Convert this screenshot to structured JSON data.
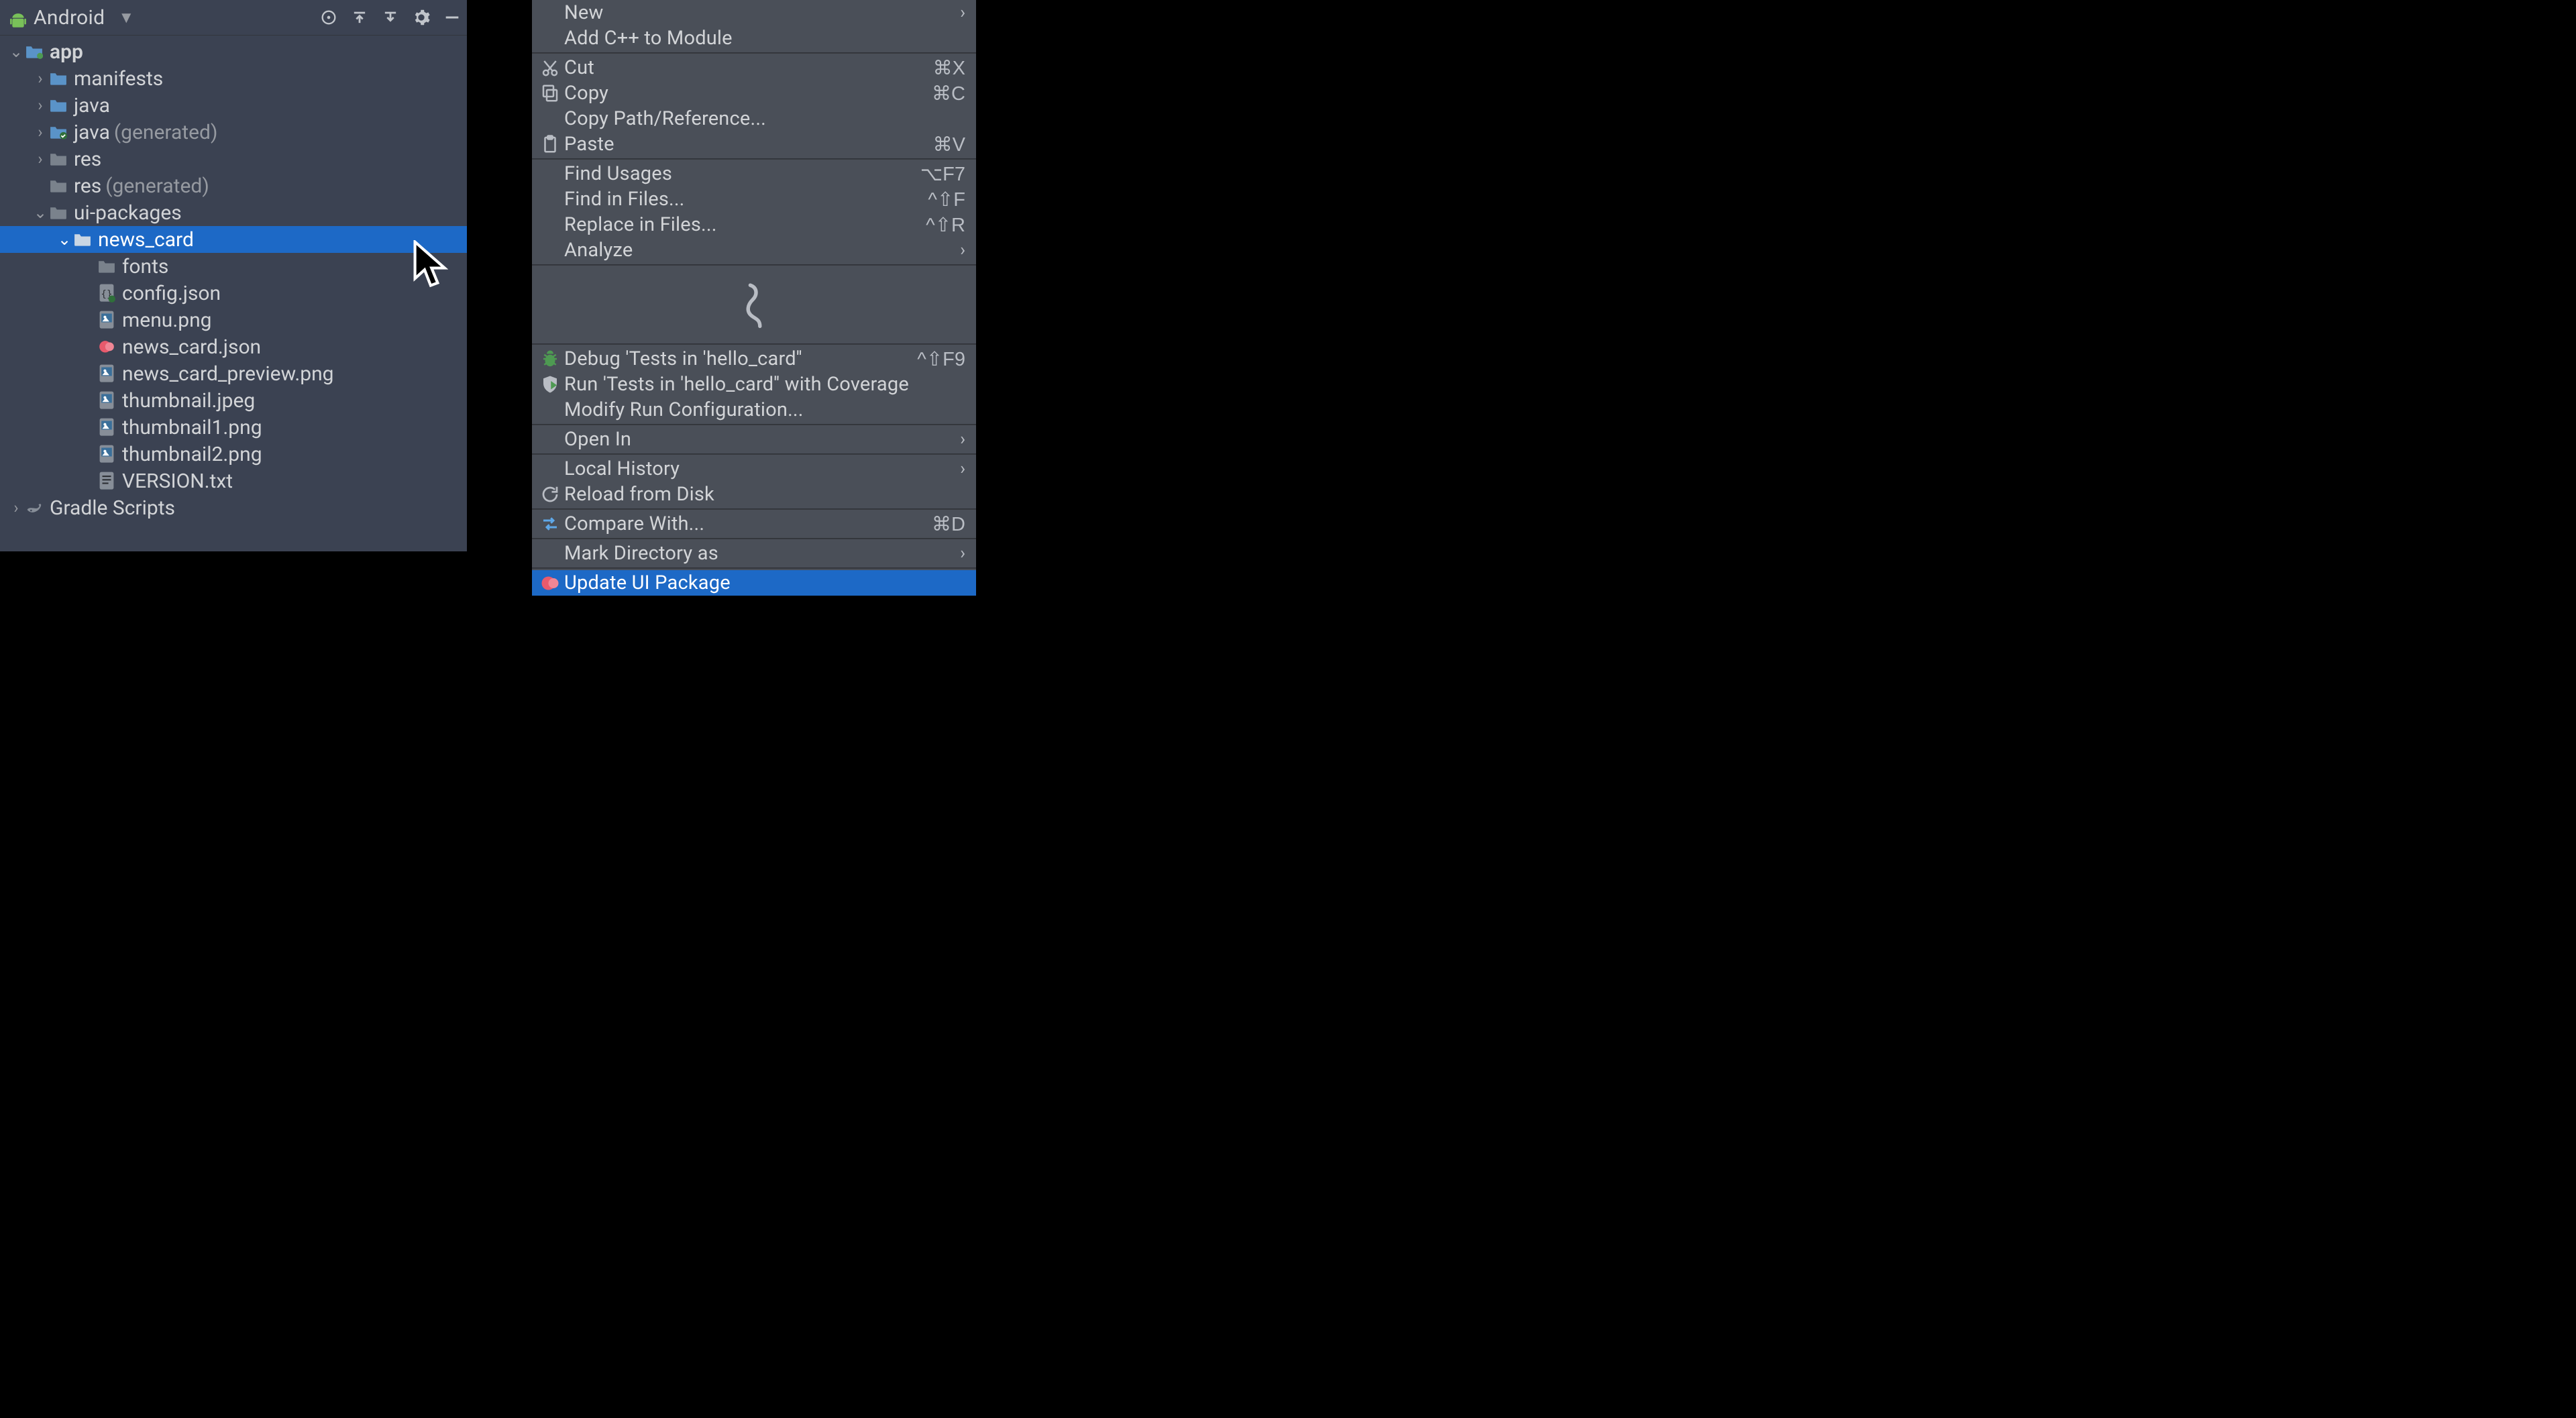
{
  "projectPanel": {
    "title": "Android",
    "toolbar": [
      "target",
      "flatten",
      "sort",
      "settings",
      "collapse"
    ]
  },
  "tree": [
    {
      "depth": 0,
      "arrow": "down",
      "icon": "app-module",
      "label": "app",
      "suffix": "",
      "bold": true,
      "selected": false
    },
    {
      "depth": 1,
      "arrow": "right",
      "icon": "folder",
      "label": "manifests",
      "suffix": "",
      "bold": false,
      "selected": false
    },
    {
      "depth": 1,
      "arrow": "right",
      "icon": "folder",
      "label": "java",
      "suffix": "",
      "bold": false,
      "selected": false
    },
    {
      "depth": 1,
      "arrow": "right",
      "icon": "folder-gen",
      "label": "java",
      "suffix": "(generated)",
      "bold": false,
      "selected": false
    },
    {
      "depth": 1,
      "arrow": "right",
      "icon": "folder-dim",
      "label": "res",
      "suffix": "",
      "bold": false,
      "selected": false
    },
    {
      "depth": 1,
      "arrow": "none",
      "icon": "folder-dim",
      "label": "res",
      "suffix": "(generated)",
      "bold": false,
      "selected": false
    },
    {
      "depth": 1,
      "arrow": "down",
      "icon": "folder-dim",
      "label": "ui-packages",
      "suffix": "",
      "bold": false,
      "selected": false
    },
    {
      "depth": 2,
      "arrow": "down",
      "icon": "folder-sel",
      "label": "news_card",
      "suffix": "",
      "bold": false,
      "selected": true
    },
    {
      "depth": 3,
      "arrow": "none",
      "icon": "folder-dim",
      "label": "fonts",
      "suffix": "",
      "bold": false,
      "selected": false
    },
    {
      "depth": 3,
      "arrow": "none",
      "icon": "json",
      "label": "config.json",
      "suffix": "",
      "bold": false,
      "selected": false
    },
    {
      "depth": 3,
      "arrow": "none",
      "icon": "png",
      "label": "menu.png",
      "suffix": "",
      "bold": false,
      "selected": false
    },
    {
      "depth": 3,
      "arrow": "none",
      "icon": "relay",
      "label": "news_card.json",
      "suffix": "",
      "bold": false,
      "selected": false
    },
    {
      "depth": 3,
      "arrow": "none",
      "icon": "png",
      "label": "news_card_preview.png",
      "suffix": "",
      "bold": false,
      "selected": false
    },
    {
      "depth": 3,
      "arrow": "none",
      "icon": "png",
      "label": "thumbnail.jpeg",
      "suffix": "",
      "bold": false,
      "selected": false
    },
    {
      "depth": 3,
      "arrow": "none",
      "icon": "png",
      "label": "thumbnail1.png",
      "suffix": "",
      "bold": false,
      "selected": false
    },
    {
      "depth": 3,
      "arrow": "none",
      "icon": "png",
      "label": "thumbnail2.png",
      "suffix": "",
      "bold": false,
      "selected": false
    },
    {
      "depth": 3,
      "arrow": "none",
      "icon": "txt",
      "label": "VERSION.txt",
      "suffix": "",
      "bold": false,
      "selected": false
    },
    {
      "depth": 0,
      "arrow": "right",
      "icon": "gradle",
      "label": "Gradle Scripts",
      "suffix": "",
      "bold": false,
      "selected": false
    }
  ],
  "contextMenu": [
    {
      "type": "item",
      "icon": "",
      "label": "New",
      "shortcut": "",
      "submenu": true,
      "hl": false
    },
    {
      "type": "item",
      "icon": "",
      "label": "Add C++ to Module",
      "shortcut": "",
      "submenu": false,
      "hl": false
    },
    {
      "type": "sep"
    },
    {
      "type": "item",
      "icon": "cut",
      "label": "Cut",
      "shortcut": "⌘X",
      "submenu": false,
      "hl": false
    },
    {
      "type": "item",
      "icon": "copy",
      "label": "Copy",
      "shortcut": "⌘C",
      "submenu": false,
      "hl": false
    },
    {
      "type": "item",
      "icon": "",
      "label": "Copy Path/Reference...",
      "shortcut": "",
      "submenu": false,
      "hl": false
    },
    {
      "type": "item",
      "icon": "paste",
      "label": "Paste",
      "shortcut": "⌘V",
      "submenu": false,
      "hl": false
    },
    {
      "type": "sep"
    },
    {
      "type": "item",
      "icon": "",
      "label": "Find Usages",
      "shortcut": "⌥F7",
      "submenu": false,
      "hl": false
    },
    {
      "type": "item",
      "icon": "",
      "label": "Find in Files...",
      "shortcut": "^⇧F",
      "submenu": false,
      "hl": false
    },
    {
      "type": "item",
      "icon": "",
      "label": "Replace in Files...",
      "shortcut": "^⇧R",
      "submenu": false,
      "hl": false
    },
    {
      "type": "item",
      "icon": "",
      "label": "Analyze",
      "shortcut": "",
      "submenu": true,
      "hl": false
    },
    {
      "type": "sep"
    },
    {
      "type": "squiggle"
    },
    {
      "type": "sep"
    },
    {
      "type": "item",
      "icon": "debug",
      "label": "Debug 'Tests in 'hello_card''",
      "shortcut": "^⇧F9",
      "submenu": false,
      "hl": false
    },
    {
      "type": "item",
      "icon": "coverage",
      "label": "Run 'Tests in 'hello_card'' with Coverage",
      "shortcut": "",
      "submenu": false,
      "hl": false
    },
    {
      "type": "item",
      "icon": "",
      "label": "Modify Run Configuration...",
      "shortcut": "",
      "submenu": false,
      "hl": false
    },
    {
      "type": "sep"
    },
    {
      "type": "item",
      "icon": "",
      "label": "Open In",
      "shortcut": "",
      "submenu": true,
      "hl": false
    },
    {
      "type": "sep"
    },
    {
      "type": "item",
      "icon": "",
      "label": "Local History",
      "shortcut": "",
      "submenu": true,
      "hl": false
    },
    {
      "type": "item",
      "icon": "reload",
      "label": "Reload from Disk",
      "shortcut": "",
      "submenu": false,
      "hl": false
    },
    {
      "type": "sep"
    },
    {
      "type": "item",
      "icon": "compare",
      "label": "Compare With...",
      "shortcut": "⌘D",
      "submenu": false,
      "hl": false
    },
    {
      "type": "sep"
    },
    {
      "type": "item",
      "icon": "",
      "label": "Mark Directory as",
      "shortcut": "",
      "submenu": true,
      "hl": false
    },
    {
      "type": "sep"
    },
    {
      "type": "item",
      "icon": "relay-pink",
      "label": "Update UI Package",
      "shortcut": "",
      "submenu": false,
      "hl": true
    }
  ]
}
